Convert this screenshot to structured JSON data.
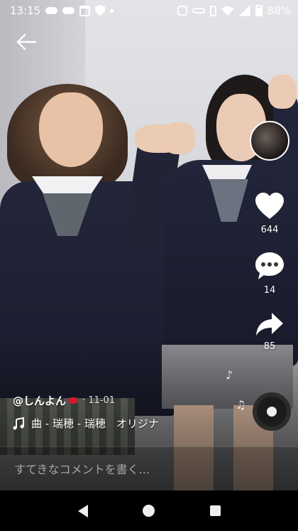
{
  "status": {
    "time": "13:15",
    "battery": "88%",
    "left_icons": [
      "cloud-icon",
      "cloud-icon",
      "calendar-icon",
      "shield-check-icon",
      "dot-icon"
    ],
    "right_icons": [
      "nfc-icon",
      "link-icon",
      "vibrate-icon",
      "wifi-icon",
      "signal-icon",
      "battery-icon"
    ]
  },
  "actions": {
    "likes": "644",
    "comments": "14",
    "shares": "85"
  },
  "caption": {
    "username": "@しんよん",
    "date": "· 11-01",
    "music": "曲 - 瑞穂 - 瑞穂　オリジナ"
  },
  "comment": {
    "placeholder": "すてきなコメントを書く..."
  },
  "colors": {
    "accent_red": "#d01a2d",
    "text": "#ffffff"
  }
}
